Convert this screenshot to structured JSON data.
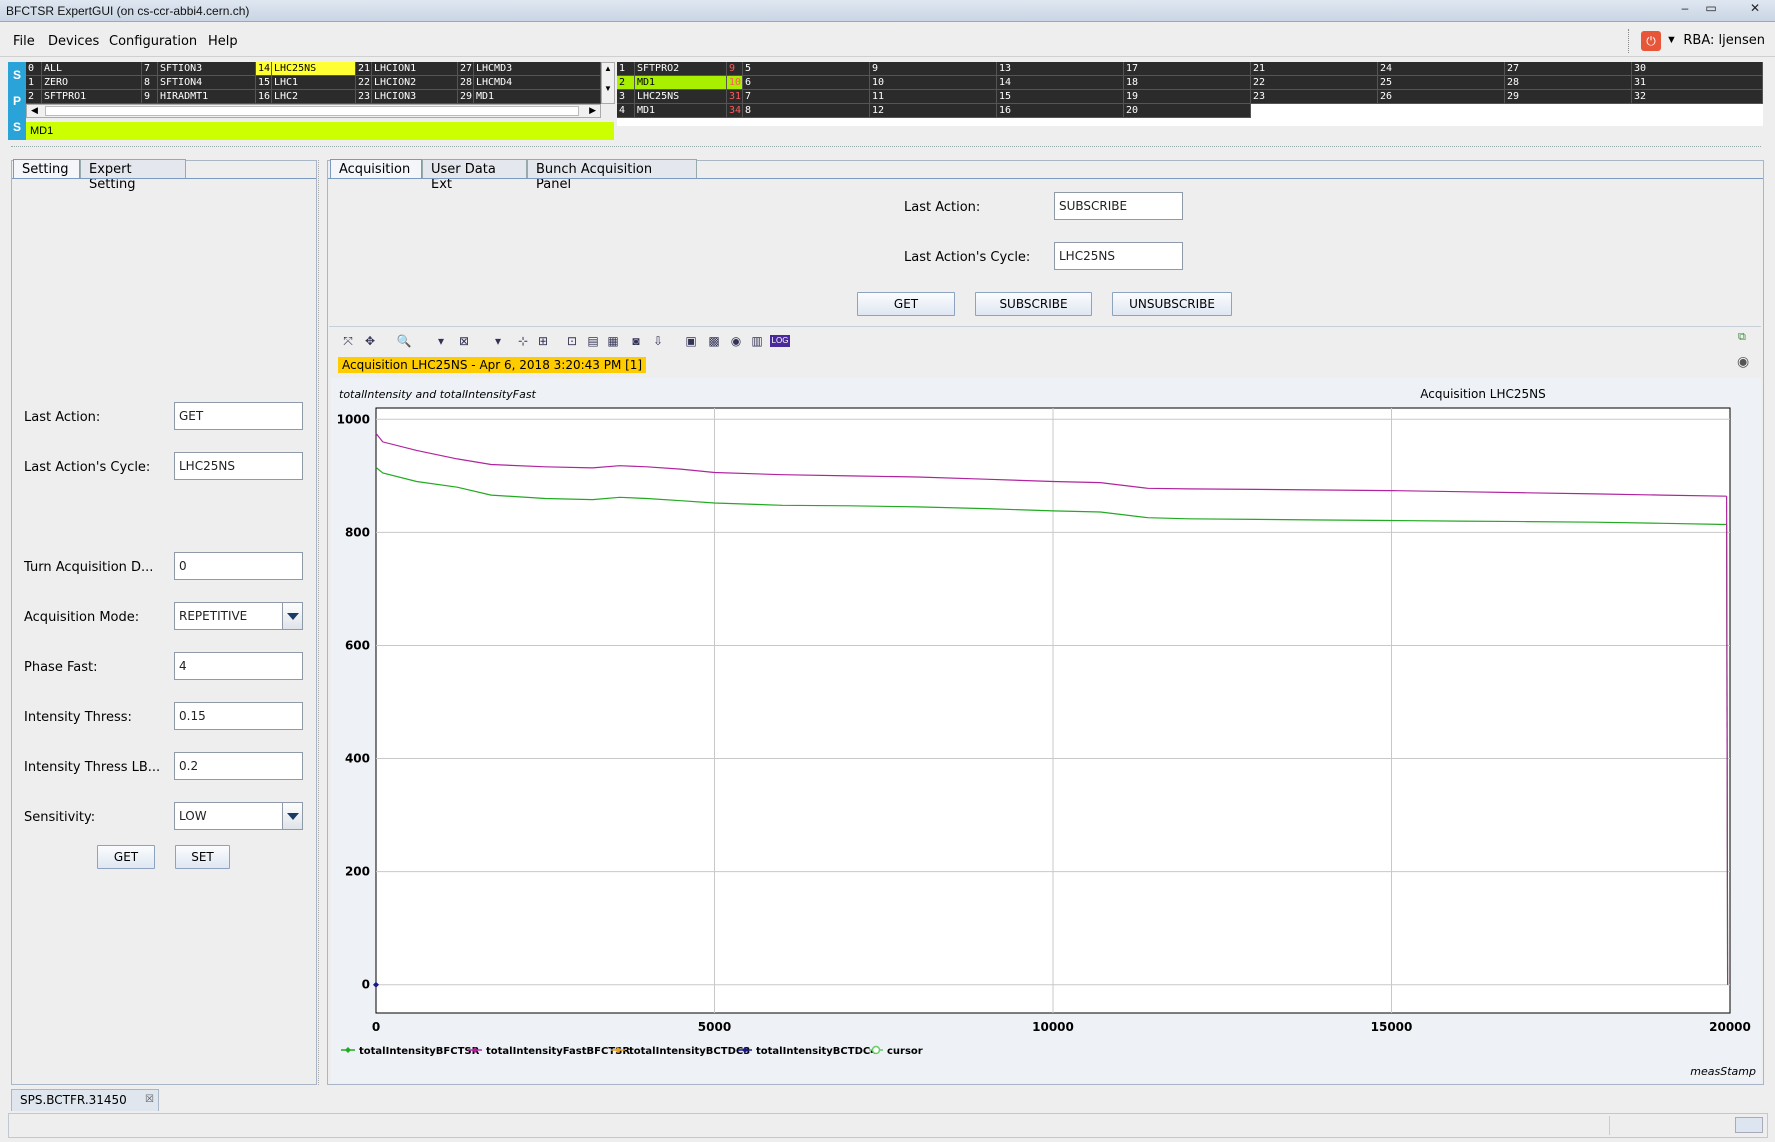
{
  "window": {
    "title": "BFCTSR ExpertGUI (on cs-ccr-abbi4.cern.ch)",
    "controls": [
      "–",
      "▭",
      "✕"
    ]
  },
  "menu": {
    "items": [
      "File",
      "Devices",
      "Configuration",
      "Help"
    ],
    "rba": "RBA: ljensen"
  },
  "selector": {
    "machine_letters": [
      "S",
      "P",
      "S"
    ],
    "left_grid": [
      {
        "n": "0",
        "name": "ALL"
      },
      {
        "n": "7",
        "name": "SFTION3"
      },
      {
        "n": "14",
        "name": "LHC25NS",
        "hl": "yellow"
      },
      {
        "n": "21",
        "name": "LHCION1"
      },
      {
        "n": "27",
        "name": "LHCMD3"
      },
      {
        "n": "1",
        "name": "ZERO"
      },
      {
        "n": "8",
        "name": "SFTION4"
      },
      {
        "n": "15",
        "name": "LHC1"
      },
      {
        "n": "22",
        "name": "LHCION2"
      },
      {
        "n": "28",
        "name": "LHCMD4"
      },
      {
        "n": "2",
        "name": "SFTPRO1"
      },
      {
        "n": "9",
        "name": "HIRADMT1"
      },
      {
        "n": "16",
        "name": "LHC2"
      },
      {
        "n": "23",
        "name": "LHCION3"
      },
      {
        "n": "29",
        "name": "MD1"
      }
    ],
    "right_rows": [
      {
        "n": "1",
        "name": "SFTPRO2",
        "cnt": "9"
      },
      {
        "n": "2",
        "name": "MD1",
        "cnt": "10",
        "hl": "green"
      },
      {
        "n": "3",
        "name": "LHC25NS",
        "cnt": "31"
      },
      {
        "n": "4",
        "name": "MD1",
        "cnt": "34"
      }
    ],
    "right_slots": [
      [
        "5",
        "9",
        "13",
        "17",
        "21",
        "24",
        "27",
        "30"
      ],
      [
        "6",
        "10",
        "14",
        "18",
        "22",
        "25",
        "28",
        "31"
      ],
      [
        "7",
        "11",
        "15",
        "19",
        "23",
        "26",
        "29",
        "32"
      ],
      [
        "8",
        "12",
        "16",
        "20"
      ]
    ],
    "selected": "MD1"
  },
  "left_panel": {
    "tabs": [
      "Setting",
      "Expert Setting"
    ],
    "fields": [
      {
        "label": "Last Action:",
        "value": "GET",
        "type": "text"
      },
      {
        "label": "Last Action's Cycle:",
        "value": "LHC25NS",
        "type": "text"
      },
      {
        "label": "Turn Acquisition D...",
        "value": "0",
        "type": "text"
      },
      {
        "label": "Acquisition Mode:",
        "value": "REPETITIVE",
        "type": "combo"
      },
      {
        "label": "Phase Fast:",
        "value": "4",
        "type": "text"
      },
      {
        "label": "Intensity Thress:",
        "value": "0.15",
        "type": "text"
      },
      {
        "label": "Intensity Thress LB...",
        "value": "0.2",
        "type": "text"
      },
      {
        "label": "Sensitivity:",
        "value": "LOW",
        "type": "combo"
      }
    ],
    "get_label": "GET",
    "set_label": "SET"
  },
  "right_panel": {
    "tabs": [
      "Acquisition",
      "User Data Ext",
      "Bunch Acquisition Panel"
    ],
    "last_action_label": "Last Action:",
    "last_action_value": "SUBSCRIBE",
    "last_cycle_label": "Last Action's Cycle:",
    "last_cycle_value": "LHC25NS",
    "buttons": [
      "GET",
      "SUBSCRIBE",
      "UNSUBSCRIBE"
    ],
    "toolbar_icons": [
      "zoom-fit-icon",
      "pan-icon",
      "magnifier-icon",
      "dropdown-icon",
      "zoom-region-icon",
      "dropdown-icon",
      "crosshair-icon",
      "grid-icon",
      "data-label-icon",
      "table-icon",
      "chart-table-icon",
      "camera-icon",
      "export-icon",
      "image-icon",
      "layout-icon",
      "color-icon",
      "split-icon",
      "log-icon"
    ],
    "log_label": "LOG",
    "plot_title_band": "Acquisition LHC25NS - Apr 6, 2018 3:20:43 PM [1]"
  },
  "chart_data": {
    "type": "line",
    "title": "Acquisition LHC25NS",
    "subtitle": "totalIntensity and totalIntensityFast",
    "xlabel": "measStamp",
    "ylabel": "",
    "xlim": [
      0,
      20000
    ],
    "ylim": [
      -50,
      1020
    ],
    "x_ticks": [
      "0",
      "5000",
      "10000",
      "15000",
      "20000"
    ],
    "y_ticks": [
      "0",
      "200",
      "400",
      "600",
      "800",
      "1000"
    ],
    "grid": true,
    "legend_position": "bottom",
    "series": [
      {
        "name": "totalIntensityBFCTSR",
        "color": "#22aa22",
        "marker": "diamond",
        "x": [
          0,
          100,
          600,
          1200,
          1700,
          2500,
          3200,
          3600,
          4000,
          4500,
          5000,
          6000,
          7000,
          8000,
          9000,
          10000,
          10700,
          11400,
          12000,
          13000,
          14000,
          15000,
          16000,
          17000,
          18000,
          19000,
          19950
        ],
        "y": [
          915,
          905,
          890,
          880,
          866,
          860,
          858,
          862,
          860,
          856,
          852,
          848,
          847,
          845,
          842,
          838,
          836,
          826,
          824,
          823,
          822,
          821,
          820,
          819,
          818,
          816,
          814
        ]
      },
      {
        "name": "totalIntensityFastBFCTSR",
        "color": "#b0249f",
        "marker": "diamond",
        "x": [
          0,
          100,
          600,
          1200,
          1700,
          2500,
          3200,
          3600,
          4000,
          4500,
          5000,
          6000,
          7000,
          8000,
          9000,
          10000,
          10700,
          11400,
          12000,
          13000,
          14000,
          15000,
          16000,
          17000,
          18000,
          19000,
          19950
        ],
        "y": [
          975,
          960,
          945,
          930,
          920,
          916,
          914,
          918,
          916,
          912,
          906,
          902,
          900,
          898,
          894,
          890,
          888,
          878,
          877,
          876,
          875,
          874,
          872,
          870,
          868,
          866,
          864
        ]
      },
      {
        "name": "totalIntensityBCTDC3",
        "color": "#e8a020",
        "marker": "diamond",
        "x": [],
        "y": []
      },
      {
        "name": "totalIntensityBCTDC4",
        "color": "#1a1a8a",
        "marker": "diamond",
        "x": [
          0
        ],
        "y": [
          0
        ]
      },
      {
        "name": "cursor",
        "color": "#66cc66",
        "marker": "circle",
        "x": [],
        "y": []
      }
    ]
  },
  "bottom": {
    "tab_label": "SPS.BCTFR.31450"
  }
}
